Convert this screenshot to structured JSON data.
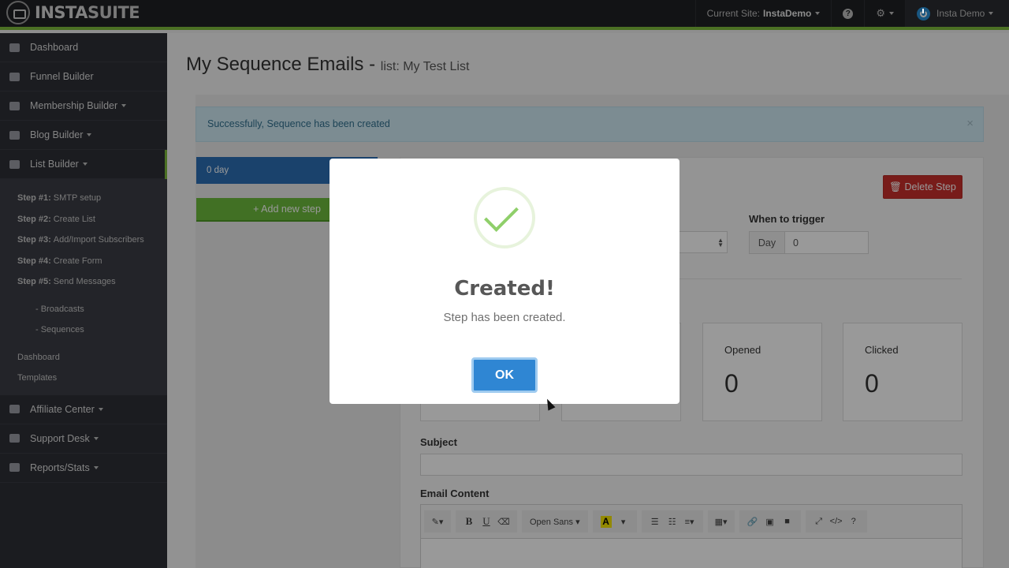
{
  "topbar": {
    "logo_part1": "INSTA",
    "logo_part2": "SUITE",
    "current_site_label": "Current Site:",
    "current_site_value": "InstaDemo",
    "user_name": "Insta Demo"
  },
  "sidebar": {
    "items": [
      {
        "label": "Dashboard"
      },
      {
        "label": "Funnel Builder"
      },
      {
        "label": "Membership Builder"
      },
      {
        "label": "Blog Builder"
      },
      {
        "label": "List Builder"
      }
    ],
    "sub": {
      "steps": [
        {
          "num": "Step #1:",
          "label": "SMTP setup"
        },
        {
          "num": "Step #2:",
          "label": "Create List"
        },
        {
          "num": "Step #3:",
          "label": "Add/Import Subscribers"
        },
        {
          "num": "Step #4:",
          "label": "Create Form"
        },
        {
          "num": "Step #5:",
          "label": "Send Messages"
        }
      ],
      "broadcasts": "- Broadcasts",
      "sequences": "- Sequences",
      "dashboard": "Dashboard",
      "templates": "Templates"
    },
    "bottom": [
      {
        "label": "Affiliate Center"
      },
      {
        "label": "Support Desk"
      },
      {
        "label": "Reports/Stats"
      }
    ]
  },
  "main": {
    "title": "My Sequence Emails -",
    "subtitle": "list: My Test List",
    "alert": "Successfully, Sequence has been created",
    "alert_close": "×",
    "step_box": "0 day",
    "add_step": "+ Add new step",
    "delete_step": "Delete Step",
    "trigger_label": "When to trigger",
    "trigger_addon": "Day",
    "trigger_value": "0",
    "stats": [
      {
        "label": "Opened",
        "value": "0"
      },
      {
        "label": "Clicked",
        "value": "0"
      }
    ],
    "subject_label": "Subject",
    "content_label": "Email Content",
    "toolbar_font": "Open Sans",
    "toolbar_highlight": "A",
    "toolbar_help": "?"
  },
  "modal": {
    "title": "Created!",
    "text": "Step has been created.",
    "ok": "OK"
  },
  "colors": {
    "accent_green": "#7dbb3d",
    "primary_blue": "#2c6fb5",
    "danger": "#c9302c"
  }
}
